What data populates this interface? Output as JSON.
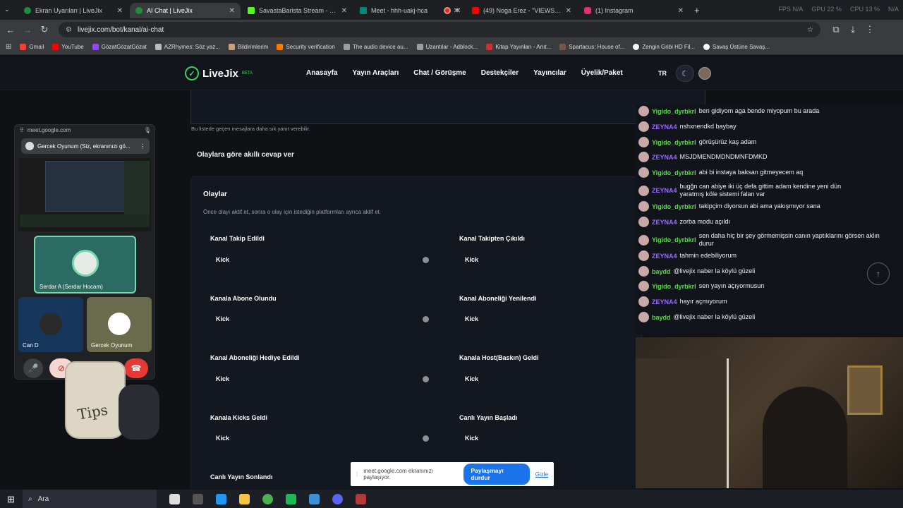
{
  "browser": {
    "tabs": [
      {
        "title": "Ekran Uyarıları | LiveJix",
        "color": "#1e8e3e",
        "active": false
      },
      {
        "title": "AI Chat | LiveJix",
        "color": "#1e8e3e",
        "active": true
      },
      {
        "title": "SavastaBarista Stream - Watch",
        "color": "#53fc18",
        "active": false
      },
      {
        "title": "Meet - hhh-uakj-hca",
        "color": "#00897b",
        "active": false
      },
      {
        "title": "",
        "color": "#d93025",
        "active": false
      },
      {
        "title": "(49) Noga Erez - \"VIEWS (feat.",
        "color": "#ff0000",
        "active": false
      },
      {
        "title": "(1) Instagram",
        "color": "#e1306c",
        "active": false
      }
    ],
    "stats": {
      "fps": "FPS N/A",
      "gpu": "GPU 22 %",
      "cpu": "CPU 13 %",
      "extra": "N/A"
    },
    "url": "livejix.com/bot/kanal/ai-chat",
    "bookmarks": [
      {
        "label": "Gmail",
        "color": "#ea4335"
      },
      {
        "label": "YouTube",
        "color": "#ff0000"
      },
      {
        "label": "GözatGözatGözat",
        "color": "#9146ff"
      },
      {
        "label": "AZRhymes: Söz yaz...",
        "color": "#bbbbbb"
      },
      {
        "label": "Bildirimlerim",
        "color": "#c8a27a"
      },
      {
        "label": "Security verification",
        "color": "#f57c00"
      },
      {
        "label": "The audio device au...",
        "color": "#9e9e9e"
      },
      {
        "label": "Uzantılar - Adblock...",
        "color": "#9e9e9e"
      },
      {
        "label": "Kitap Yayınları - Anıt...",
        "color": "#d32f2f"
      },
      {
        "label": "Spartacus: House of...",
        "color": "#795548"
      },
      {
        "label": "Zengin Gribi HD Fil...",
        "color": "#ffffff"
      },
      {
        "label": "Savaş Üstüne Savaş...",
        "color": "#ffffff"
      }
    ]
  },
  "site": {
    "brand": "LiveJix",
    "badge": "BETA",
    "nav": [
      "Anasayfa",
      "Yayın Araçları",
      "Chat / Görüşme",
      "Destekçiler",
      "Yayıncılar",
      "Üyelik/Paket"
    ],
    "lang": "TR",
    "accent": "#3ccf5c"
  },
  "main": {
    "hint": "Bu listede geçen mesajlara daha sık yanıt verebilir.",
    "smart_reply_label": "Olaylara göre akıllı cevap ver",
    "events_title": "Olaylar",
    "events_desc": "Önce olayı aktif et, sonra o olay için istediğin platformları ayrıca aktif et.",
    "events": [
      {
        "title": "Kanal Takip Edildi",
        "platform": "Kick"
      },
      {
        "title": "Kanal Takipten Çıkıldı",
        "platform": "Kick"
      },
      {
        "title": "Kanala Abone Olundu",
        "platform": "Kick"
      },
      {
        "title": "Kanal Aboneliği Yenilendi",
        "platform": "Kick"
      },
      {
        "title": "Kanal Aboneliği Hediye Edildi",
        "platform": "Kick"
      },
      {
        "title": "Kanala Host(Baskın) Geldi",
        "platform": "Kick"
      },
      {
        "title": "Kanala Kicks Geldi",
        "platform": "Kick"
      },
      {
        "title": "Canlı Yayın Başladı",
        "platform": "Kick"
      },
      {
        "title": "Canlı Yayın Sonlandı",
        "platform": ""
      }
    ]
  },
  "meet": {
    "host": "meet.google.com",
    "caption": "Gercek Oyunum (Siz, ekranınızı gö...",
    "tiles": [
      "Serdar A (Serdar Hocam)",
      "Can D",
      "Gercek Oyunum"
    ],
    "tips_text": "Tips"
  },
  "chat": {
    "messages": [
      {
        "user": "Yigido_dyrbkrl",
        "color": "#5bd94a",
        "text": "ben gidiyom aga bende miyopum bu arada"
      },
      {
        "user": "ZEYNA4",
        "color": "#9b6bff",
        "text": "nshxnendkd baybay"
      },
      {
        "user": "Yigido_dyrbkrl",
        "color": "#5bd94a",
        "text": "görüşürüz kaş adam"
      },
      {
        "user": "ZEYNA4",
        "color": "#9b6bff",
        "text": "MSJDMENDMDNDMNFDMKD"
      },
      {
        "user": "Yigido_dyrbkrl",
        "color": "#5bd94a",
        "text": "abi bi instaya baksan gitmeyecem aq"
      },
      {
        "user": "ZEYNA4",
        "color": "#9b6bff",
        "text": "bugğn can abiye iki üç defa gittim adam kendine yeni dün yaratmış köle sistemi falan var"
      },
      {
        "user": "Yigido_dyrbkrl",
        "color": "#5bd94a",
        "text": "takipçim diyorsun abi ama yakışmıyor sana"
      },
      {
        "user": "ZEYNA4",
        "color": "#9b6bff",
        "text": "zorba modu açıldı"
      },
      {
        "user": "Yigido_dyrbkrl",
        "color": "#5bd94a",
        "text": "sen daha hiç bir şey görmemişsin canın yaptıklarını görsen aklın durur"
      },
      {
        "user": "ZEYNA4",
        "color": "#9b6bff",
        "text": "tahmin edebiliyorum"
      },
      {
        "user": "baydd",
        "color": "#5bd94a",
        "text": "@livejix naber la köylü güzeli"
      },
      {
        "user": "Yigido_dyrbkrl",
        "color": "#5bd94a",
        "text": "sen yayın açıyormusun"
      },
      {
        "user": "ZEYNA4",
        "color": "#9b6bff",
        "text": "hayır açmıyorum"
      },
      {
        "user": "baydd",
        "color": "#5bd94a",
        "text": "@livejix naber la köylü güzeli"
      }
    ]
  },
  "share_notice": {
    "text": "meet.google.com ekranınızı paylaşıyor.",
    "stop": "Paylaşmayı durdur",
    "hide": "Gizle"
  },
  "taskbar": {
    "search_placeholder": "Ara"
  }
}
